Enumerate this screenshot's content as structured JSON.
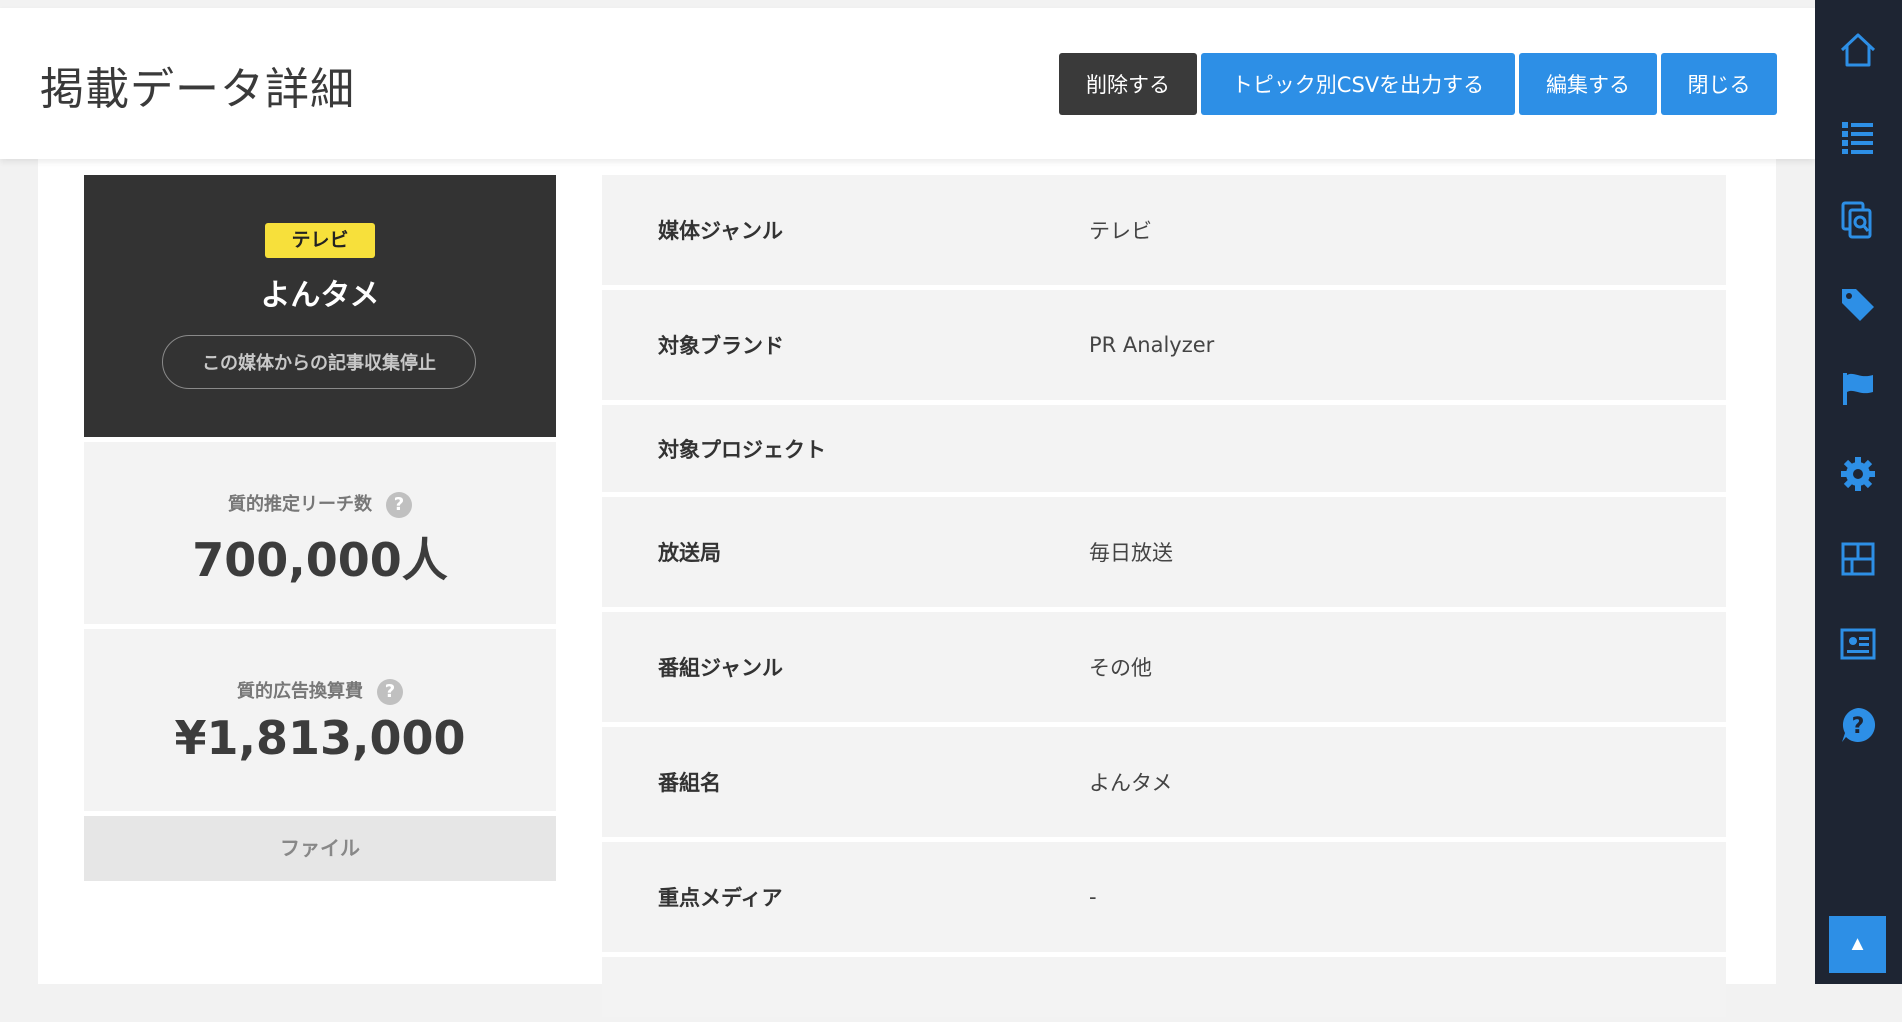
{
  "header": {
    "title": "掲載データ詳細",
    "buttons": {
      "delete": "削除する",
      "csv": "トピック別CSVを出力する",
      "edit": "編集する",
      "close": "閉じる"
    }
  },
  "media": {
    "genre_badge": "テレビ",
    "name": "よんタメ",
    "stop_button": "この媒体からの記事収集停止"
  },
  "stats": {
    "reach_label": "質的推定リーチ数",
    "reach_value": "700,000人",
    "ad_label": "質的広告換算費",
    "ad_value": "¥1,813,000",
    "help_glyph": "?"
  },
  "file_label": "ファイル",
  "details": [
    {
      "label": "媒体ジャンル",
      "value": "テレビ"
    },
    {
      "label": "対象ブランド",
      "value": "PR Analyzer"
    },
    {
      "label": "対象プロジェクト",
      "value": ""
    },
    {
      "label": "放送局",
      "value": "毎日放送"
    },
    {
      "label": "番組ジャンル",
      "value": "その他"
    },
    {
      "label": "番組名",
      "value": "よんタメ"
    },
    {
      "label": "重点メディア",
      "value": "-"
    }
  ],
  "sidebar": {
    "icons": [
      "home-icon",
      "list-icon",
      "document-search-icon",
      "tag-icon",
      "flag-icon",
      "gear-icon",
      "dashboard-grid-icon",
      "report-icon",
      "help-icon"
    ],
    "scroll_top_glyph": "▲"
  },
  "colors": {
    "accent": "#2d8fe6",
    "dark_button": "#3a3a3a",
    "badge": "#f7e03b",
    "sidebar": "#1e2533",
    "media_card": "#333333"
  }
}
